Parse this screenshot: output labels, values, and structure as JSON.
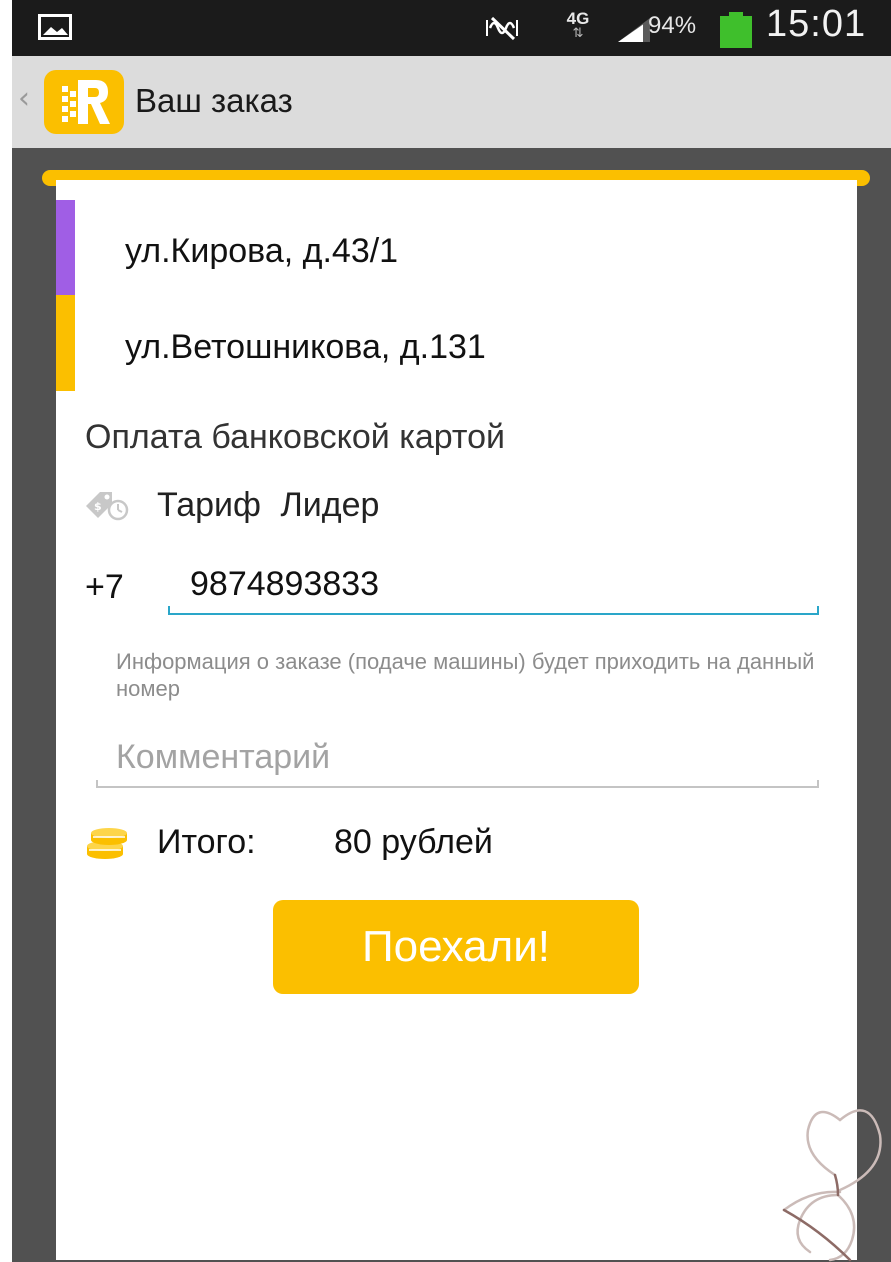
{
  "status_bar": {
    "network_type": "4G",
    "network_arrows": "⇅",
    "battery_percent": "94%",
    "time": "15:01",
    "battery_color": "#3fbf2c"
  },
  "action_bar": {
    "title": "Ваш заказ",
    "back_glyph": "‹",
    "brand_color": "#fbbf00"
  },
  "order": {
    "route": [
      {
        "address": "ул.Кирова, д.43/1",
        "marker_color": "#a05ee5"
      },
      {
        "address": "ул.Ветошникова, д.131",
        "marker_color": "#fbbf00"
      }
    ],
    "payment_method": "Оплата банковской картой",
    "tariff": "Тариф  Лидер",
    "phone": {
      "prefix": "+7",
      "value": "9874893833",
      "hint": "Информация о заказе (подаче машины) будет приходить на данный номер"
    },
    "comment": {
      "placeholder": "Комментарий",
      "value": ""
    },
    "total": {
      "label": "Итого:",
      "value": "80 рублей"
    },
    "submit_label": "Поехали!"
  },
  "icons": {
    "gallery": "gallery-notification-icon",
    "mute": "mute-icon",
    "signal": "signal-strength-icon",
    "battery": "battery-icon",
    "logo": "app-logo-icon",
    "tariff": "tariff-icon",
    "coins": "coins-icon"
  }
}
